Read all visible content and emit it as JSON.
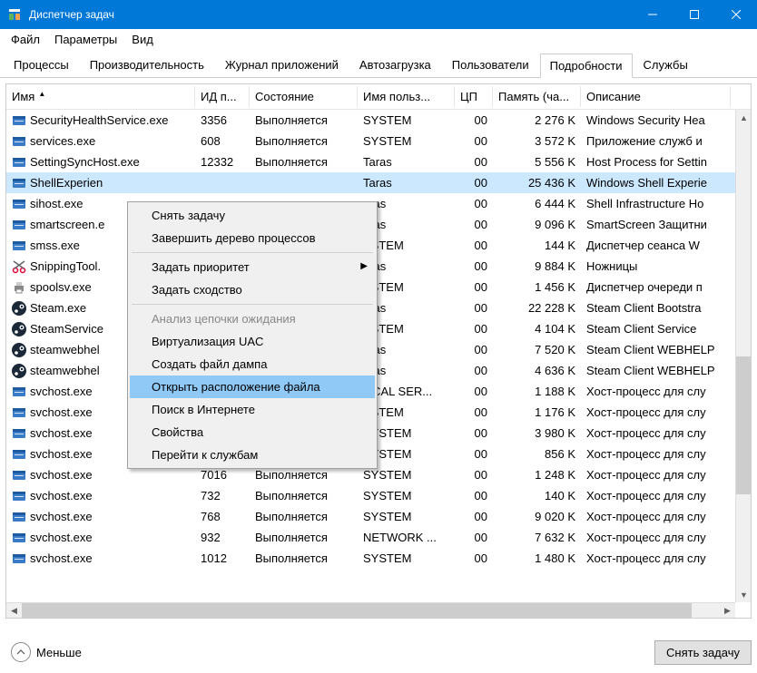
{
  "window": {
    "title": "Диспетчер задач"
  },
  "menu": {
    "file": "Файл",
    "options": "Параметры",
    "view": "Вид"
  },
  "tabs": {
    "processes": "Процессы",
    "performance": "Производительность",
    "app_history": "Журнал приложений",
    "startup": "Автозагрузка",
    "users": "Пользователи",
    "details": "Подробности",
    "services": "Службы"
  },
  "columns": {
    "name": "Имя",
    "pid": "ИД п...",
    "status": "Состояние",
    "user": "Имя польз...",
    "cpu": "ЦП",
    "memory": "Память (ча...",
    "description": "Описание"
  },
  "rows": [
    {
      "icon": "app",
      "name": "SecurityHealthService.exe",
      "pid": "3356",
      "status": "Выполняется",
      "user": "SYSTEM",
      "cpu": "00",
      "mem": "2 276 K",
      "desc": "Windows Security Hea"
    },
    {
      "icon": "app",
      "name": "services.exe",
      "pid": "608",
      "status": "Выполняется",
      "user": "SYSTEM",
      "cpu": "00",
      "mem": "3 572 K",
      "desc": "Приложение служб и"
    },
    {
      "icon": "app",
      "name": "SettingSyncHost.exe",
      "pid": "12332",
      "status": "Выполняется",
      "user": "Taras",
      "cpu": "00",
      "mem": "5 556 K",
      "desc": "Host Process for Settin"
    },
    {
      "icon": "app",
      "name": "ShellExperien",
      "pid": "",
      "status": "",
      "user": "Taras",
      "cpu": "00",
      "mem": "25 436 K",
      "desc": "Windows Shell Experie",
      "selected": true
    },
    {
      "icon": "app",
      "name": "sihost.exe",
      "pid": "",
      "status": "",
      "user": "aras",
      "cpu": "00",
      "mem": "6 444 K",
      "desc": "Shell Infrastructure Ho"
    },
    {
      "icon": "app",
      "name": "smartscreen.e",
      "pid": "",
      "status": "",
      "user": "aras",
      "cpu": "00",
      "mem": "9 096 K",
      "desc": "SmartScreen Защитни"
    },
    {
      "icon": "app",
      "name": "smss.exe",
      "pid": "",
      "status": "",
      "user": "YSTEM",
      "cpu": "00",
      "mem": "144 K",
      "desc": "Диспетчер сеанса  W"
    },
    {
      "icon": "snip",
      "name": "SnippingTool.",
      "pid": "",
      "status": "",
      "user": "aras",
      "cpu": "00",
      "mem": "9 884 K",
      "desc": "Ножницы"
    },
    {
      "icon": "printer",
      "name": "spoolsv.exe",
      "pid": "",
      "status": "",
      "user": "YSTEM",
      "cpu": "00",
      "mem": "1 456 K",
      "desc": "Диспетчер очереди п"
    },
    {
      "icon": "steam",
      "name": "Steam.exe",
      "pid": "",
      "status": "",
      "user": "aras",
      "cpu": "00",
      "mem": "22 228 K",
      "desc": "Steam Client Bootstra"
    },
    {
      "icon": "steam",
      "name": "SteamService",
      "pid": "",
      "status": "",
      "user": "YSTEM",
      "cpu": "00",
      "mem": "4 104 K",
      "desc": "Steam Client Service"
    },
    {
      "icon": "steam",
      "name": "steamwebhel",
      "pid": "",
      "status": "",
      "user": "aras",
      "cpu": "00",
      "mem": "7 520 K",
      "desc": "Steam Client WEBHELP"
    },
    {
      "icon": "steam",
      "name": "steamwebhel",
      "pid": "",
      "status": "",
      "user": "aras",
      "cpu": "00",
      "mem": "4 636 K",
      "desc": "Steam Client WEBHELP"
    },
    {
      "icon": "app",
      "name": "svchost.exe",
      "pid": "",
      "status": "",
      "user": "OCAL SER...",
      "cpu": "00",
      "mem": "1 188 K",
      "desc": "Хост-процесс для слу"
    },
    {
      "icon": "app",
      "name": "svchost.exe",
      "pid": "",
      "status": "",
      "user": "YSTEM",
      "cpu": "00",
      "mem": "1 176 K",
      "desc": "Хост-процесс для слу"
    },
    {
      "icon": "app",
      "name": "svchost.exe",
      "pid": "9092",
      "status": "Выполняется",
      "user": "SYSTEM",
      "cpu": "00",
      "mem": "3 980 K",
      "desc": "Хост-процесс для слу"
    },
    {
      "icon": "app",
      "name": "svchost.exe",
      "pid": "14512",
      "status": "Выполняется",
      "user": "SYSTEM",
      "cpu": "00",
      "mem": "856 K",
      "desc": "Хост-процесс для слу"
    },
    {
      "icon": "app",
      "name": "svchost.exe",
      "pid": "7016",
      "status": "Выполняется",
      "user": "SYSTEM",
      "cpu": "00",
      "mem": "1 248 K",
      "desc": "Хост-процесс для слу"
    },
    {
      "icon": "app",
      "name": "svchost.exe",
      "pid": "732",
      "status": "Выполняется",
      "user": "SYSTEM",
      "cpu": "00",
      "mem": "140 K",
      "desc": "Хост-процесс для слу"
    },
    {
      "icon": "app",
      "name": "svchost.exe",
      "pid": "768",
      "status": "Выполняется",
      "user": "SYSTEM",
      "cpu": "00",
      "mem": "9 020 K",
      "desc": "Хост-процесс для слу"
    },
    {
      "icon": "app",
      "name": "svchost.exe",
      "pid": "932",
      "status": "Выполняется",
      "user": "NETWORK ...",
      "cpu": "00",
      "mem": "7 632 K",
      "desc": "Хост-процесс для слу"
    },
    {
      "icon": "app",
      "name": "svchost.exe",
      "pid": "1012",
      "status": "Выполняется",
      "user": "SYSTEM",
      "cpu": "00",
      "mem": "1 480 K",
      "desc": "Хост-процесс для слу"
    }
  ],
  "context_menu": {
    "end_task": "Снять задачу",
    "end_tree": "Завершить дерево процессов",
    "set_priority": "Задать приоритет",
    "set_affinity": "Задать сходство",
    "analyze_wait": "Анализ цепочки ожидания",
    "uac_virt": "Виртуализация UAC",
    "create_dump": "Создать файл дампа",
    "open_location": "Открыть расположение файла",
    "search_online": "Поиск в Интернете",
    "properties": "Свойства",
    "goto_services": "Перейти к службам"
  },
  "footer": {
    "less": "Меньше",
    "end_task_btn": "Снять задачу"
  }
}
